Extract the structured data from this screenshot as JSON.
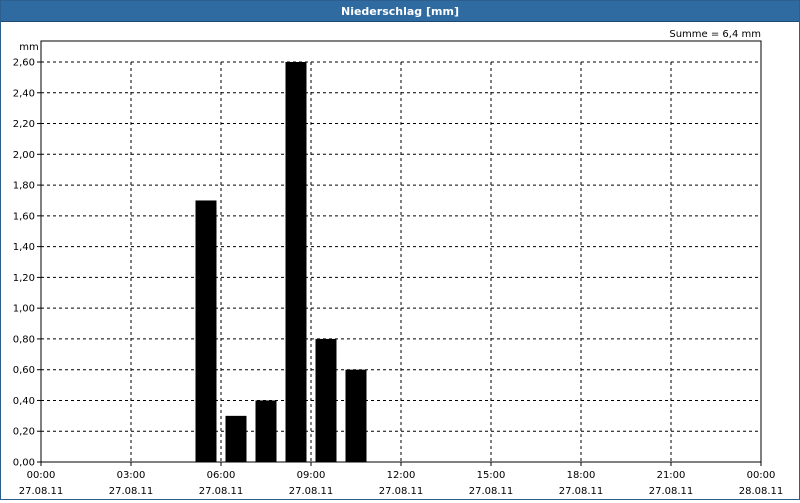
{
  "window": {
    "title": "Niederschlag [mm]"
  },
  "chart_data": {
    "type": "bar",
    "title": "Niederschlag [mm]",
    "ylabel": "mm",
    "summary": "Summe = 6,4 mm",
    "ylim": [
      0,
      2.6
    ],
    "yticks": [
      0,
      0.2,
      0.4,
      0.6,
      0.8,
      1.0,
      1.2,
      1.4,
      1.6,
      1.8,
      2.0,
      2.2,
      2.4,
      2.6
    ],
    "ytick_labels": [
      "0,00",
      "0,20",
      "0,40",
      "0,60",
      "0,80",
      "1,00",
      "1,20",
      "1,40",
      "1,60",
      "1,80",
      "2,00",
      "2,20",
      "2,40",
      "2,60"
    ],
    "xlim_hours": [
      0,
      24
    ],
    "xticks": [
      {
        "hour": 0,
        "time": "00:00",
        "date": "27.08.11"
      },
      {
        "hour": 3,
        "time": "03:00",
        "date": "27.08.11"
      },
      {
        "hour": 6,
        "time": "06:00",
        "date": "27.08.11"
      },
      {
        "hour": 9,
        "time": "09:00",
        "date": "27.08.11"
      },
      {
        "hour": 12,
        "time": "12:00",
        "date": "27.08.11"
      },
      {
        "hour": 15,
        "time": "15:00",
        "date": "27.08.11"
      },
      {
        "hour": 18,
        "time": "18:00",
        "date": "27.08.11"
      },
      {
        "hour": 21,
        "time": "21:00",
        "date": "27.08.11"
      },
      {
        "hour": 24,
        "time": "00:00",
        "date": "28.08.11"
      }
    ],
    "bars": [
      {
        "hour": 5,
        "value": 1.7
      },
      {
        "hour": 6,
        "value": 0.3
      },
      {
        "hour": 7,
        "value": 0.4
      },
      {
        "hour": 8,
        "value": 2.6
      },
      {
        "hour": 9,
        "value": 0.8
      },
      {
        "hour": 10,
        "value": 0.6
      }
    ],
    "grid": true,
    "bar_color": "#000000"
  }
}
